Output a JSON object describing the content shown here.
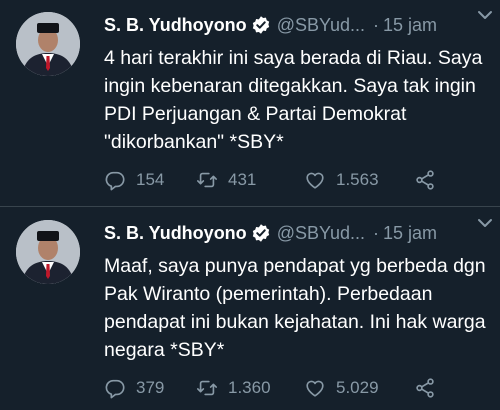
{
  "colors": {
    "background": "#15202b",
    "text": "#ffffff",
    "muted": "#8899a6",
    "verified_badge": "#ffffff",
    "divider": "#38444d"
  },
  "tweets": [
    {
      "name": "S. B. Yudhoyono",
      "handle": "@SBYud...",
      "separator": "·",
      "time": "15 jam",
      "text": "4 hari terakhir ini saya berada di Riau. Saya ingin kebenaran ditegakkan. Saya tak ingin PDI Perjuangan & Partai Demokrat \"dikorbankan\" *SBY*",
      "replies": "154",
      "retweets": "431",
      "likes": "1.563",
      "icons": [
        "verified-badge-icon",
        "chevron-down-icon",
        "reply-icon",
        "retweet-icon",
        "heart-icon",
        "share-icon"
      ]
    },
    {
      "name": "S. B. Yudhoyono",
      "handle": "@SBYud...",
      "separator": "·",
      "time": "15 jam",
      "text": "Maaf, saya punya pendapat yg berbeda dgn Pak Wiranto (pemerintah). Perbedaan pendapat ini bukan kejahatan. Ini hak warga negara *SBY*",
      "replies": "379",
      "retweets": "1.360",
      "likes": "5.029",
      "icons": [
        "verified-badge-icon",
        "chevron-down-icon",
        "reply-icon",
        "retweet-icon",
        "heart-icon",
        "share-icon"
      ]
    }
  ]
}
